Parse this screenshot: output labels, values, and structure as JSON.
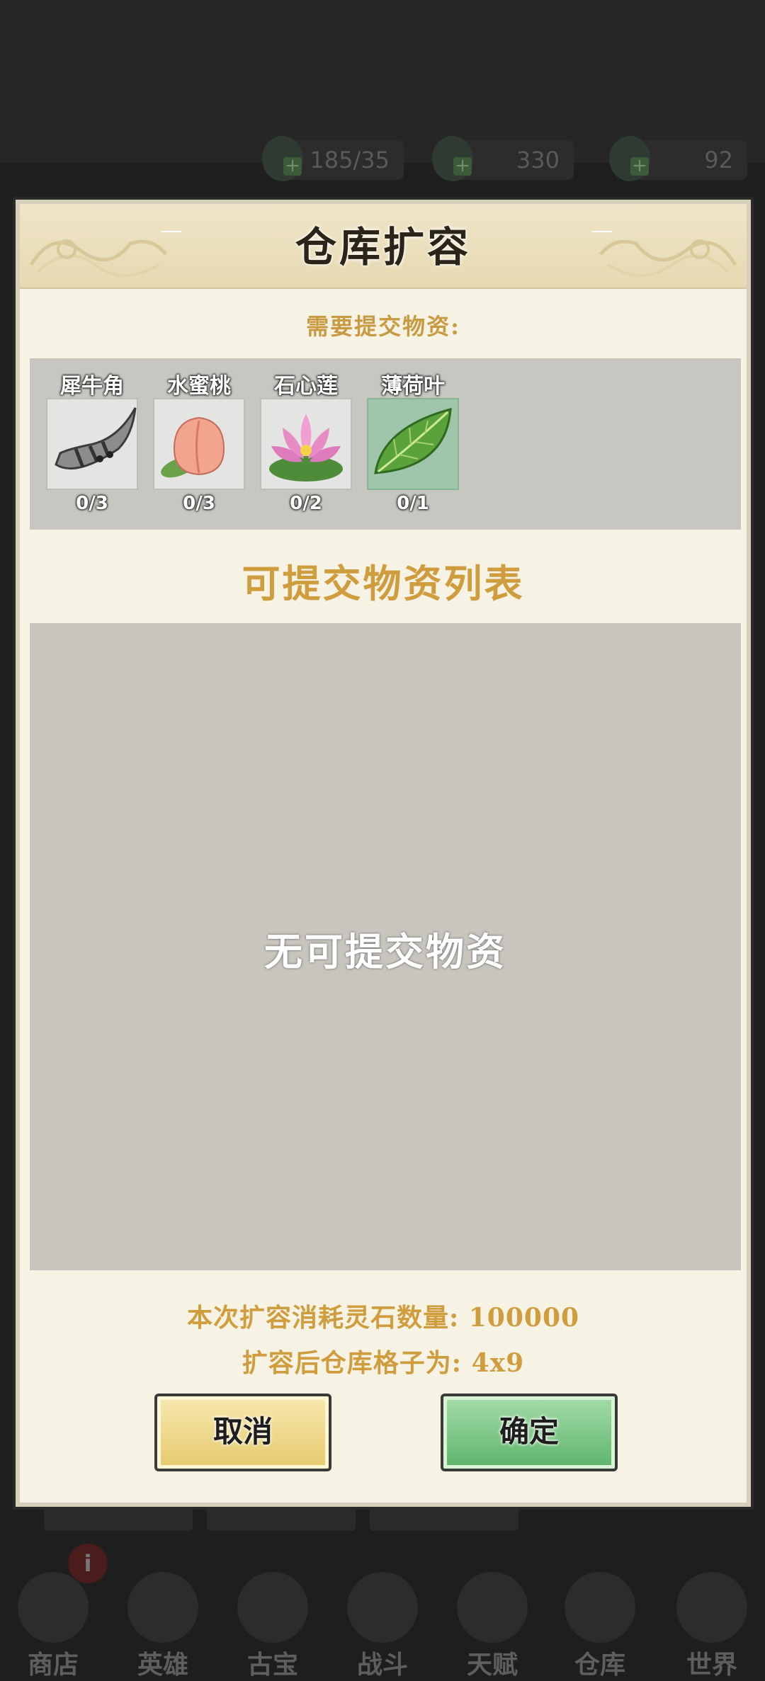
{
  "resources": [
    {
      "value": "185/35",
      "icon": "water-drop-icon"
    },
    {
      "value": "330",
      "icon": "coin-bag-icon"
    },
    {
      "value": "92",
      "icon": "spirit-stone-icon"
    }
  ],
  "dialog": {
    "title": "仓库扩容",
    "need_label": "需要提交物资:",
    "required_items": [
      {
        "name": "犀牛角",
        "count": "0/3",
        "icon": "rhino-horn-icon"
      },
      {
        "name": "水蜜桃",
        "count": "0/3",
        "icon": "peach-icon"
      },
      {
        "name": "石心莲",
        "count": "0/2",
        "icon": "lotus-icon"
      },
      {
        "name": "薄荷叶",
        "count": "0/1",
        "icon": "mint-leaf-icon"
      }
    ],
    "list_title": "可提交物资列表",
    "empty_text": "无可提交物资",
    "cost_line": "本次扩容消耗灵石数量: 100000",
    "result_line": "扩容后仓库格子为: 4x9",
    "cancel_label": "取消",
    "confirm_label": "确定"
  },
  "bottom_nav": [
    {
      "label": "商店",
      "icon": "shop-pagoda-icon"
    },
    {
      "label": "英雄",
      "icon": "hero-icon"
    },
    {
      "label": "古宝",
      "icon": "gourd-icon"
    },
    {
      "label": "战斗",
      "icon": "yin-yang-icon"
    },
    {
      "label": "天赋",
      "icon": "meditation-icon"
    },
    {
      "label": "仓库",
      "icon": "storage-bag-icon"
    },
    {
      "label": "世界",
      "icon": "cloud-world-icon"
    }
  ],
  "nav_badge": "i",
  "colors": {
    "accent_gold": "#d09d3e",
    "confirm_green": "#5cb46a",
    "cancel_yellow": "#e5c96c",
    "panel_gray": "#c8c5be"
  }
}
